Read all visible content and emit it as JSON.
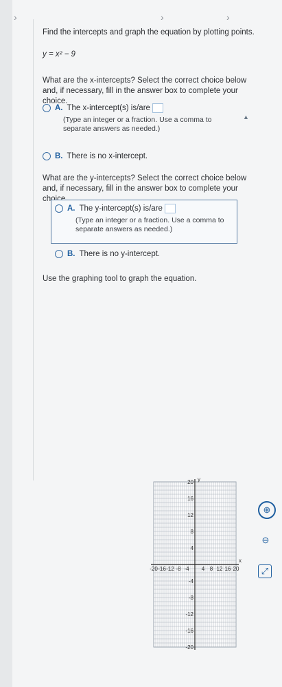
{
  "problem": {
    "instruction": "Find the intercepts and graph the equation by plotting points.",
    "equation": "y = x² − 9"
  },
  "x_intercepts": {
    "question": "What are the x-intercepts? Select the correct choice below and, if necessary, fill in the answer box to complete your choice.",
    "option_a_letter": "A.",
    "option_a_text": "The x-intercept(s) is/are",
    "option_a_hint": "(Type an integer or a fraction. Use a comma to separate answers as needed.)",
    "option_b_letter": "B.",
    "option_b_text": "There is no x-intercept."
  },
  "y_intercepts": {
    "question": "What are the y-intercepts? Select the correct choice below and, if necessary, fill in the answer box to complete your choice.",
    "option_a_letter": "A.",
    "option_a_text": "The y-intercept(s) is/are",
    "option_a_hint": "(Type an integer or a fraction. Use a comma to separate answers as needed.)",
    "option_b_letter": "B.",
    "option_b_text": "There is no y-intercept."
  },
  "graph_instruction": "Use the graphing tool to graph the equation.",
  "graph": {
    "x_label": "x",
    "y_label": "y",
    "x_ticks": [
      "-20",
      "-16",
      "-12",
      "-8",
      "-4",
      "4",
      "8",
      "12",
      "16",
      "20"
    ],
    "y_ticks": [
      "20",
      "16",
      "12",
      "8",
      "4",
      "-4",
      "-8",
      "-12",
      "-16",
      "-20"
    ]
  },
  "tools": {
    "zoom_in_icon": "zoom-in-icon",
    "zoom_out_icon": "zoom-out-icon",
    "expand_icon": "expand-icon"
  },
  "colors": {
    "accent": "#1f5fa0",
    "grid": "#9aa3ad",
    "axis": "#222222"
  }
}
